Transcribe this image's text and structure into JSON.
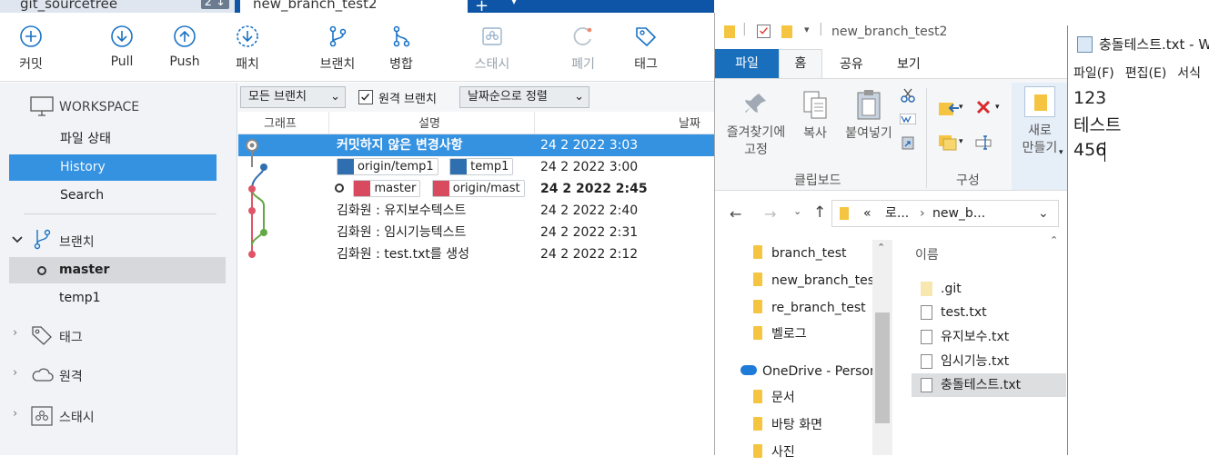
{
  "tabs": {
    "tab1_label": "git_sourcetree",
    "tab1_count": "2 ↓",
    "tab2_label": "new_branch_test2",
    "plus": "+",
    "dropdown": "▾"
  },
  "toolbar": {
    "commit": "커밋",
    "pull": "Pull",
    "push": "Push",
    "fetch": "패치",
    "branch": "브랜치",
    "merge": "병합",
    "stash": "스태시",
    "discard": "폐기",
    "tag": "태그"
  },
  "sidebar": {
    "workspace": "WORKSPACE",
    "file_status": "파일 상태",
    "history": "History",
    "search": "Search",
    "branches": "브랜치",
    "branch_items": [
      "master",
      "temp1"
    ],
    "tags": "태그",
    "remotes": "원격",
    "stashes": "스태시"
  },
  "filters": {
    "all_branches": "모든 브랜치",
    "remote_branches": "원격 브랜치",
    "sort": "날짜순으로 정렬"
  },
  "columns": {
    "graph": "그래프",
    "description": "설명",
    "date": "날짜"
  },
  "commits": [
    {
      "desc": "커밋하지 않은 변경사항",
      "date": "24 2 2022 3:03"
    },
    {
      "desc": "",
      "tags": [
        "origin/temp1",
        "temp1"
      ],
      "date": "24 2 2022 3:00"
    },
    {
      "desc": "",
      "tags": [
        "master",
        "origin/mast"
      ],
      "date": "24 2 2022 2:45"
    },
    {
      "desc": "김화원 : 유지보수텍스트",
      "date": "24 2 2022 2:40"
    },
    {
      "desc": "김화원 :  임시기능텍스트",
      "date": "24 2 2022 2:31"
    },
    {
      "desc": "김화원 : test.txt를 생성",
      "date": "24 2 2022 2:12"
    }
  ],
  "explorer": {
    "title": "new_branch_test2",
    "ribbon_tabs": [
      "파일",
      "홈",
      "공유",
      "보기"
    ],
    "pin": "즐겨찾기에\n고정",
    "copy": "복사",
    "paste": "붙여넣기",
    "clipboard_group": "클립보드",
    "organize_group": "구성",
    "new_label": "새로\n만들기",
    "address": [
      "«",
      "로...",
      "›",
      "new_b..."
    ],
    "tree": [
      "branch_test",
      "new_branch_test",
      "re_branch_test",
      "벨로그",
      "OneDrive - Person",
      "문서",
      "바탕 화면",
      "사진"
    ],
    "name_header": "이름",
    "files": [
      ".git",
      "test.txt",
      "유지보수.txt",
      "임시기능.txt",
      "충돌테스트.txt"
    ]
  },
  "notepad": {
    "title": "충돌테스트.txt - W",
    "menu": [
      "파일(F)",
      "편집(E)",
      "서식"
    ],
    "lines": [
      "123",
      "테스트",
      "456"
    ]
  },
  "colors": {
    "accent": "#3592e1",
    "ribbon_blue": "#1a6fbd",
    "graph_red": "#e05468",
    "graph_green": "#64a845",
    "graph_blue": "#2f6fb0"
  }
}
